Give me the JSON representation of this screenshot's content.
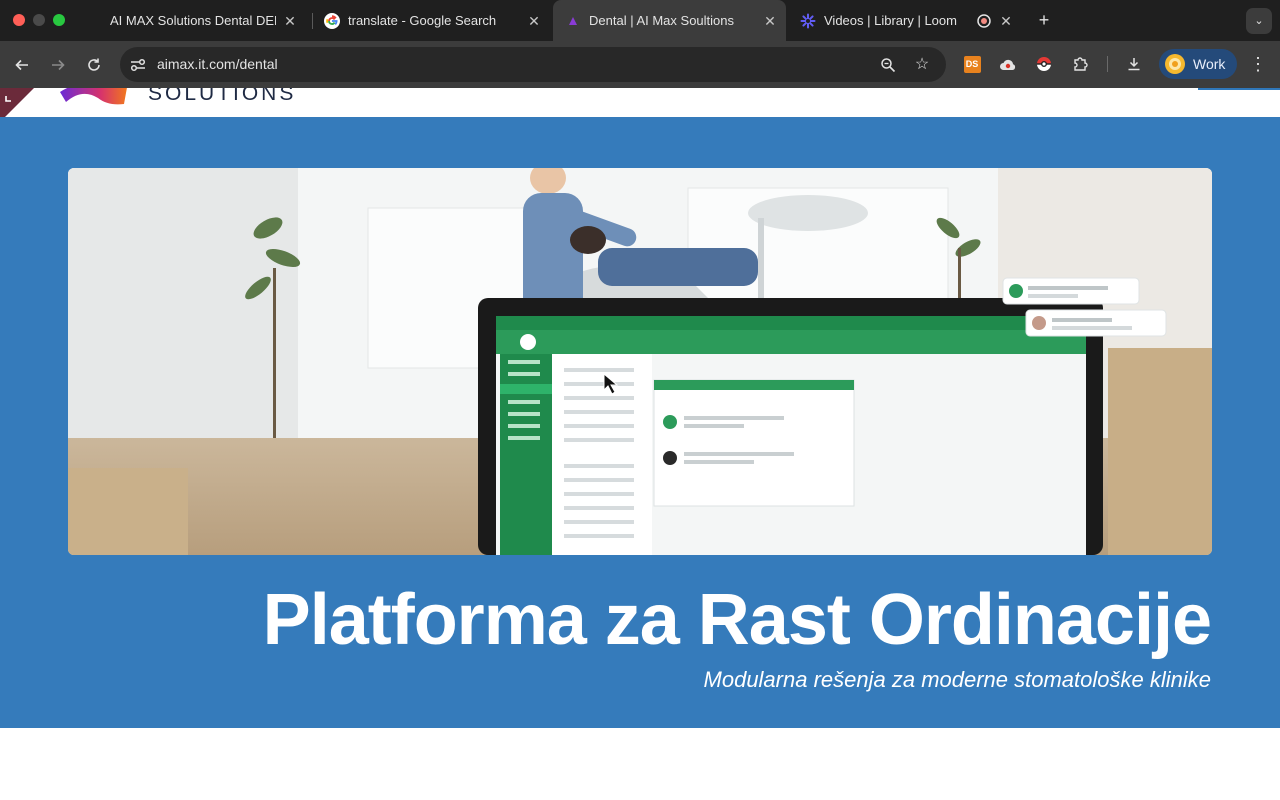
{
  "browser": {
    "tabs": [
      {
        "title": "AI MAX Solutions Dental DEM",
        "icon": "blank-page-icon",
        "active": false
      },
      {
        "title": "translate - Google Search",
        "icon": "google-icon",
        "active": false
      },
      {
        "title": "Dental | AI Max Soultions",
        "icon": "aimax-favicon",
        "active": true
      },
      {
        "title": "Videos | Library | Loom",
        "icon": "loom-icon",
        "active": false
      }
    ],
    "url": "aimax.it.com/dental",
    "profile_label": "Work",
    "extension_ds_label": "DS"
  },
  "site": {
    "logo_text": "SOLUTIONS"
  },
  "hero": {
    "title": "Platforma za Rast Ordinacije",
    "subtitle": "Modularna rešenja za moderne stomatološke klinike",
    "image_alt_subject": "dentist-with-patient-and-whatsapp-laptop"
  },
  "colors": {
    "hero_background": "#357bbb",
    "whatsapp_green": "#1f8a4c",
    "chrome_dark": "#1f1f1f",
    "chrome_toolbar": "#3c3c3c",
    "profile_chip": "#244a7a"
  }
}
